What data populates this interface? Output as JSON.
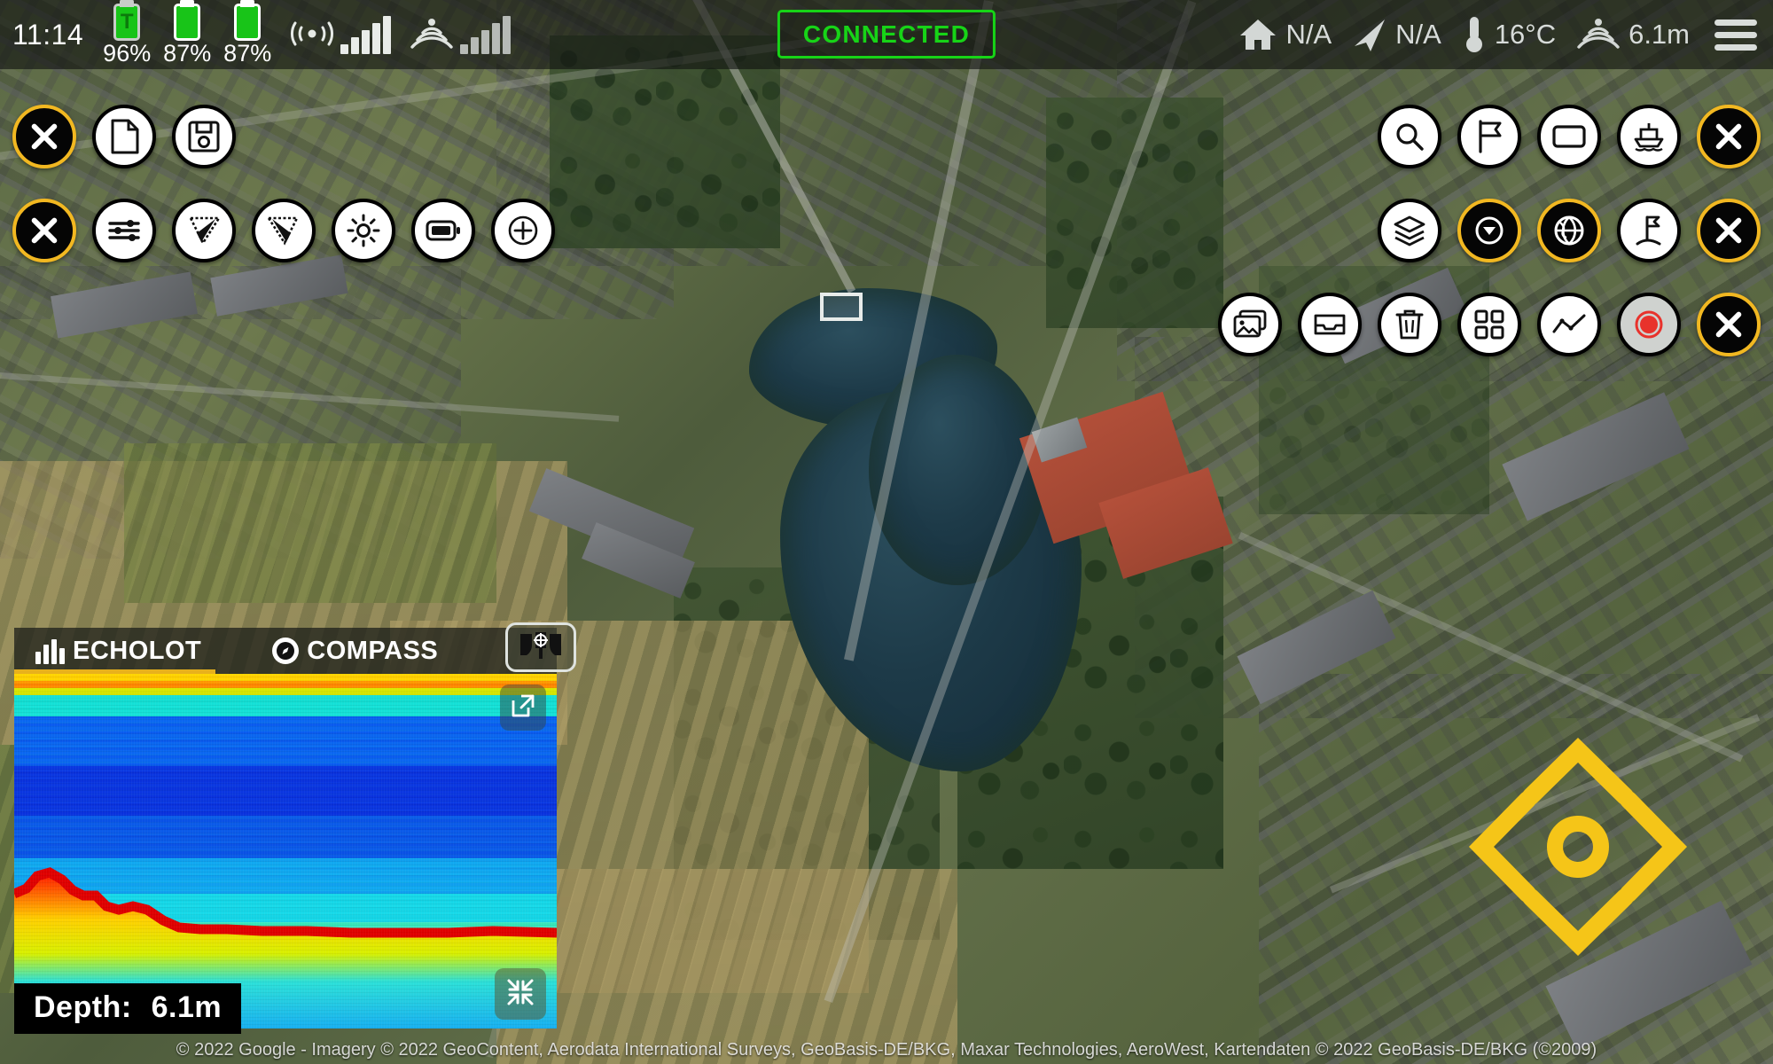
{
  "statusbar": {
    "clock": "11:14",
    "batteries": [
      {
        "name": "tablet-battery",
        "pct": "96%",
        "letter": "T"
      },
      {
        "name": "boat-battery-1",
        "pct": "87%",
        "letter": ""
      },
      {
        "name": "boat-battery-2",
        "pct": "87%",
        "letter": ""
      }
    ],
    "connection_status": "CONNECTED",
    "connection_color": "#17d417",
    "home_distance": "N/A",
    "gps_distance": "N/A",
    "temperature": "16°C",
    "sonar_depth": "6.1m",
    "icons": {
      "wifi": "wifi-icon",
      "radar": "radar-icon",
      "signal_1": "signal-bars-icon",
      "signal_2": "signal-bars-icon",
      "home": "home-icon",
      "navigation": "navigation-arrow-icon",
      "thermometer": "thermometer-icon",
      "sonar": "sonar-wave-icon",
      "menu": "hamburger-menu-icon"
    }
  },
  "left_toolbar": {
    "row1": [
      {
        "name": "close-left-row1-button",
        "icon": "close-x-icon",
        "label": "Close",
        "state": "close"
      },
      {
        "name": "new-file-button",
        "icon": "file-icon",
        "label": "New File",
        "state": "normal"
      },
      {
        "name": "save-button",
        "icon": "floppy-save-icon",
        "label": "Save",
        "state": "normal"
      }
    ],
    "row2": [
      {
        "name": "close-left-row2-button",
        "icon": "close-x-icon",
        "label": "Close",
        "state": "close"
      },
      {
        "name": "settings-sliders-button",
        "icon": "sliders-icon",
        "label": "Settings",
        "state": "normal"
      },
      {
        "name": "sonar-beam-left-button",
        "icon": "sonar-cone-left-icon",
        "label": "Left Beam",
        "state": "normal"
      },
      {
        "name": "sonar-beam-right-button",
        "icon": "sonar-cone-right-icon",
        "label": "Right Beam",
        "state": "normal"
      },
      {
        "name": "brightness-button",
        "icon": "sun-brightness-icon",
        "label": "Brightness",
        "state": "normal"
      },
      {
        "name": "battery-button",
        "icon": "battery-icon",
        "label": "Battery",
        "state": "normal"
      },
      {
        "name": "zoom-in-button",
        "icon": "plus-circle-icon",
        "label": "Zoom In",
        "state": "normal"
      }
    ]
  },
  "right_toolbar": {
    "row1": [
      {
        "name": "search-button",
        "icon": "search-icon",
        "label": "Search",
        "state": "normal"
      },
      {
        "name": "waypoint-flag-button",
        "icon": "flag-icon",
        "label": "Waypoint",
        "state": "normal"
      },
      {
        "name": "area-rectangle-button",
        "icon": "rectangle-icon",
        "label": "Area",
        "state": "normal"
      },
      {
        "name": "boat-button",
        "icon": "boat-icon",
        "label": "Boat",
        "state": "normal"
      },
      {
        "name": "close-right-row1-button",
        "icon": "close-x-icon",
        "label": "Close",
        "state": "close"
      }
    ],
    "row2": [
      {
        "name": "map-layers-button",
        "icon": "layers-icon",
        "label": "Layers",
        "state": "normal"
      },
      {
        "name": "center-position-button",
        "icon": "location-target-icon",
        "label": "Center",
        "state": "active"
      },
      {
        "name": "satellite-globe-button",
        "icon": "globe-icon",
        "label": "Satellite",
        "state": "active"
      },
      {
        "name": "marker-flag-button",
        "icon": "golf-flag-icon",
        "label": "Marker",
        "state": "normal"
      },
      {
        "name": "close-right-row2-button",
        "icon": "close-x-icon",
        "label": "Close",
        "state": "close"
      }
    ],
    "row3": [
      {
        "name": "gallery-button",
        "icon": "photo-gallery-icon",
        "label": "Gallery",
        "state": "normal"
      },
      {
        "name": "inbox-button",
        "icon": "inbox-tray-icon",
        "label": "Inbox",
        "state": "normal"
      },
      {
        "name": "delete-button",
        "icon": "trash-icon",
        "label": "Delete",
        "state": "normal"
      },
      {
        "name": "grid-view-button",
        "icon": "grid-icon",
        "label": "Grid",
        "state": "normal"
      },
      {
        "name": "chart-button",
        "icon": "line-chart-icon",
        "label": "Chart",
        "state": "normal"
      },
      {
        "name": "record-button",
        "icon": "record-dot-icon",
        "label": "Record",
        "state": "record"
      },
      {
        "name": "close-right-row3-button",
        "icon": "close-x-icon",
        "label": "Close",
        "state": "close"
      }
    ]
  },
  "sonar_panel": {
    "tabs": [
      {
        "name": "tab-echolot",
        "label": "ECHOLOT",
        "active": true,
        "icon": "bar-chart-icon"
      },
      {
        "name": "tab-compass",
        "label": "COMPASS",
        "active": false,
        "icon": "compass-icon"
      }
    ],
    "active_tab_underline_color": "#E8B11C",
    "depth_label": "Depth:",
    "depth_value": "6.1m",
    "boat_view_button": "boat-top-view-icon",
    "expand_button": "expand-external-icon",
    "collapse_button": "collapse-inward-icon"
  },
  "map": {
    "target_marker": "target-diamond-marker",
    "target_marker_color": "#F5C518",
    "boat_marker": "boat-rectangle-marker",
    "attribution": "© 2022 Google - Imagery © 2022 GeoContent, Aerodata International Surveys, GeoBasis-DE/BKG, Maxar Technologies, AeroWest, Kartendaten © 2022 GeoBasis-DE/BKG (©2009)"
  }
}
